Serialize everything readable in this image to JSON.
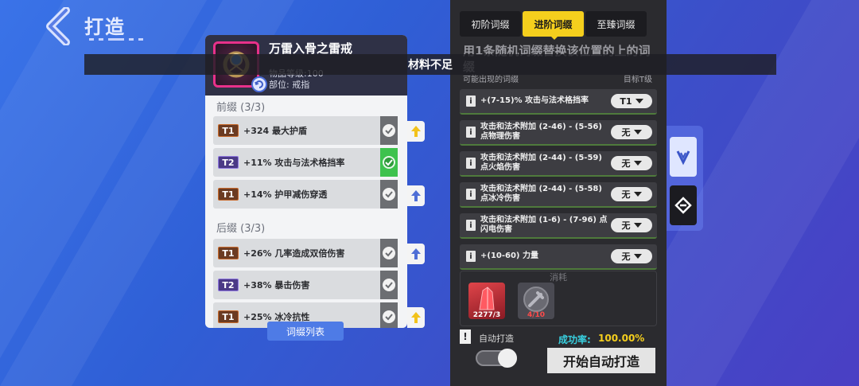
{
  "header": {
    "title": "打造"
  },
  "toast": {
    "message": "材料不足"
  },
  "item": {
    "name": "万雷入骨之雷戒",
    "level": "物品等级:100",
    "slot": "部位: 戒指"
  },
  "prefix": {
    "label": "前缀 (3/3)",
    "affixes": [
      {
        "tier": "T1",
        "text": "+324 最大护盾"
      },
      {
        "tier": "T2",
        "text": "+11% 攻击与法术格挡率"
      },
      {
        "tier": "T1",
        "text": "+14% 护甲减伤穿透"
      }
    ]
  },
  "suffix": {
    "label": "后缀 (3/3)",
    "affixes": [
      {
        "tier": "T1",
        "text": "+26% 几率造成双倍伤害"
      },
      {
        "tier": "T2",
        "text": "+38% 暴击伤害"
      },
      {
        "tier": "T1",
        "text": "+25% 冰冷抗性"
      }
    ]
  },
  "affix_list_button": "词缀列表",
  "panel": {
    "tabs": [
      "初阶词缀",
      "进阶词缀",
      "至臻词缀"
    ],
    "instruction": "用1条随机词缀替换该位置的上的词缀",
    "col_left": "可能出现的词缀",
    "col_right": "目标T级",
    "options": [
      {
        "text": "+(7-15)% 攻击与法术格挡率",
        "value": "T1"
      },
      {
        "text": "攻击和法术附加 (2-46) - (5-56) 点物理伤害",
        "value": "无"
      },
      {
        "text": "攻击和法术附加 (2-44) - (5-59) 点火焰伤害",
        "value": "无"
      },
      {
        "text": "攻击和法术附加 (2-44) - (5-58) 点冰冷伤害",
        "value": "无"
      },
      {
        "text": "攻击和法术附加 (1-6) - (7-96) 点闪电伤害",
        "value": "无"
      },
      {
        "text": "+(10-60) 力量",
        "value": "无"
      }
    ],
    "cost_label": "消耗",
    "materials": [
      {
        "name": "red-crystal",
        "qty": "2277/3"
      },
      {
        "name": "hammer-token",
        "qty": "4/10"
      }
    ],
    "auto_label": "自动打造",
    "rate_label": "成功率:",
    "rate_value": "100.00%",
    "start_button": "开始自动打造"
  }
}
